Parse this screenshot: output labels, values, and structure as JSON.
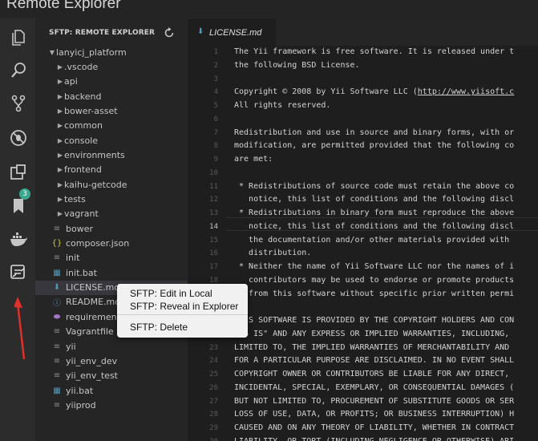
{
  "window": {
    "title": "Remote Explorer"
  },
  "activity_bar": {
    "items": [
      {
        "name": "explorer-icon"
      },
      {
        "name": "search-icon"
      },
      {
        "name": "source-control-icon"
      },
      {
        "name": "debug-icon"
      },
      {
        "name": "extensions-icon",
        "badge": "3"
      },
      {
        "name": "bookmarks-icon"
      },
      {
        "name": "docker-icon"
      },
      {
        "name": "sftp-remote-explorer-icon"
      }
    ],
    "arrow_color": "#e0302b"
  },
  "sidebar": {
    "header": "SFTP: REMOTE EXPLORER",
    "root": "lanyicj_platform",
    "items": [
      {
        "label": ".vscode",
        "type": "folder"
      },
      {
        "label": "api",
        "type": "folder"
      },
      {
        "label": "backend",
        "type": "folder"
      },
      {
        "label": "bower-asset",
        "type": "folder"
      },
      {
        "label": "common",
        "type": "folder"
      },
      {
        "label": "console",
        "type": "folder"
      },
      {
        "label": "environments",
        "type": "folder"
      },
      {
        "label": "frontend",
        "type": "folder"
      },
      {
        "label": "kaihu-getcode",
        "type": "folder"
      },
      {
        "label": "tests",
        "type": "folder"
      },
      {
        "label": "vagrant",
        "type": "folder"
      },
      {
        "label": "bower",
        "type": "file",
        "icon": "≡"
      },
      {
        "label": "composer.json",
        "type": "file",
        "icon": "{}"
      },
      {
        "label": "init",
        "type": "file",
        "icon": "≡"
      },
      {
        "label": "init.bat",
        "type": "file",
        "icon": "▦"
      },
      {
        "label": "LICENSE.md",
        "type": "file",
        "icon": "⬇",
        "selected": true
      },
      {
        "label": "README.md",
        "type": "file",
        "icon": "ⓘ"
      },
      {
        "label": "requirements.php",
        "type": "file",
        "icon": "⬬"
      },
      {
        "label": "Vagrantfile",
        "type": "file",
        "icon": "≡"
      },
      {
        "label": "yii",
        "type": "file",
        "icon": "≡"
      },
      {
        "label": "yii_env_dev",
        "type": "file",
        "icon": "≡"
      },
      {
        "label": "yii_env_test",
        "type": "file",
        "icon": "≡"
      },
      {
        "label": "yii.bat",
        "type": "file",
        "icon": "▦"
      },
      {
        "label": "yiiprod",
        "type": "file",
        "icon": "≡"
      }
    ]
  },
  "editor": {
    "tab_label": "LICENSE.md",
    "current_line": 14,
    "lines": [
      "The Yii framework is free software. It is released under t",
      "the following BSD License.",
      "",
      "Copyright © 2008 by Yii Software LLC (http://www.yiisoft.c",
      "All rights reserved.",
      "",
      "Redistribution and use in source and binary forms, with or",
      "modification, are permitted provided that the following co",
      "are met:",
      "",
      " * Redistributions of source code must retain the above co",
      "   notice, this list of conditions and the following discl",
      " * Redistributions in binary form must reproduce the above",
      "   notice, this list of conditions and the following discl",
      "   the documentation and/or other materials provided with ",
      "   distribution.",
      " * Neither the name of Yii Software LLC nor the names of i",
      "   contributors may be used to endorse or promote products",
      "   from this software without specific prior written permi",
      "",
      "THIS SOFTWARE IS PROVIDED BY THE COPYRIGHT HOLDERS AND CON",
      "\"AS IS\" AND ANY EXPRESS OR IMPLIED WARRANTIES, INCLUDING, ",
      "LIMITED TO, THE IMPLIED WARRANTIES OF MERCHANTABILITY AND ",
      "FOR A PARTICULAR PURPOSE ARE DISCLAIMED. IN NO EVENT SHALL",
      "COPYRIGHT OWNER OR CONTRIBUTORS BE LIABLE FOR ANY DIRECT, ",
      "INCIDENTAL, SPECIAL, EXEMPLARY, OR CONSEQUENTIAL DAMAGES (",
      "BUT NOT LIMITED TO, PROCUREMENT OF SUBSTITUTE GOODS OR SER",
      "LOSS OF USE, DATA, OR PROFITS; OR BUSINESS INTERRUPTION) H",
      "CAUSED AND ON ANY THEORY OF LIABILITY, WHETHER IN CONTRACT",
      "LIABILITY, OR TORT (INCLUDING NEGLIGENCE OR OTHERWISE) ARI"
    ],
    "link_text": "http://www.yiisoft.c"
  },
  "context_menu": {
    "items": [
      {
        "label": "SFTP: Edit in Local"
      },
      {
        "label": "SFTP: Reveal in Explorer"
      },
      {
        "label": "SFTP: Delete"
      }
    ]
  }
}
